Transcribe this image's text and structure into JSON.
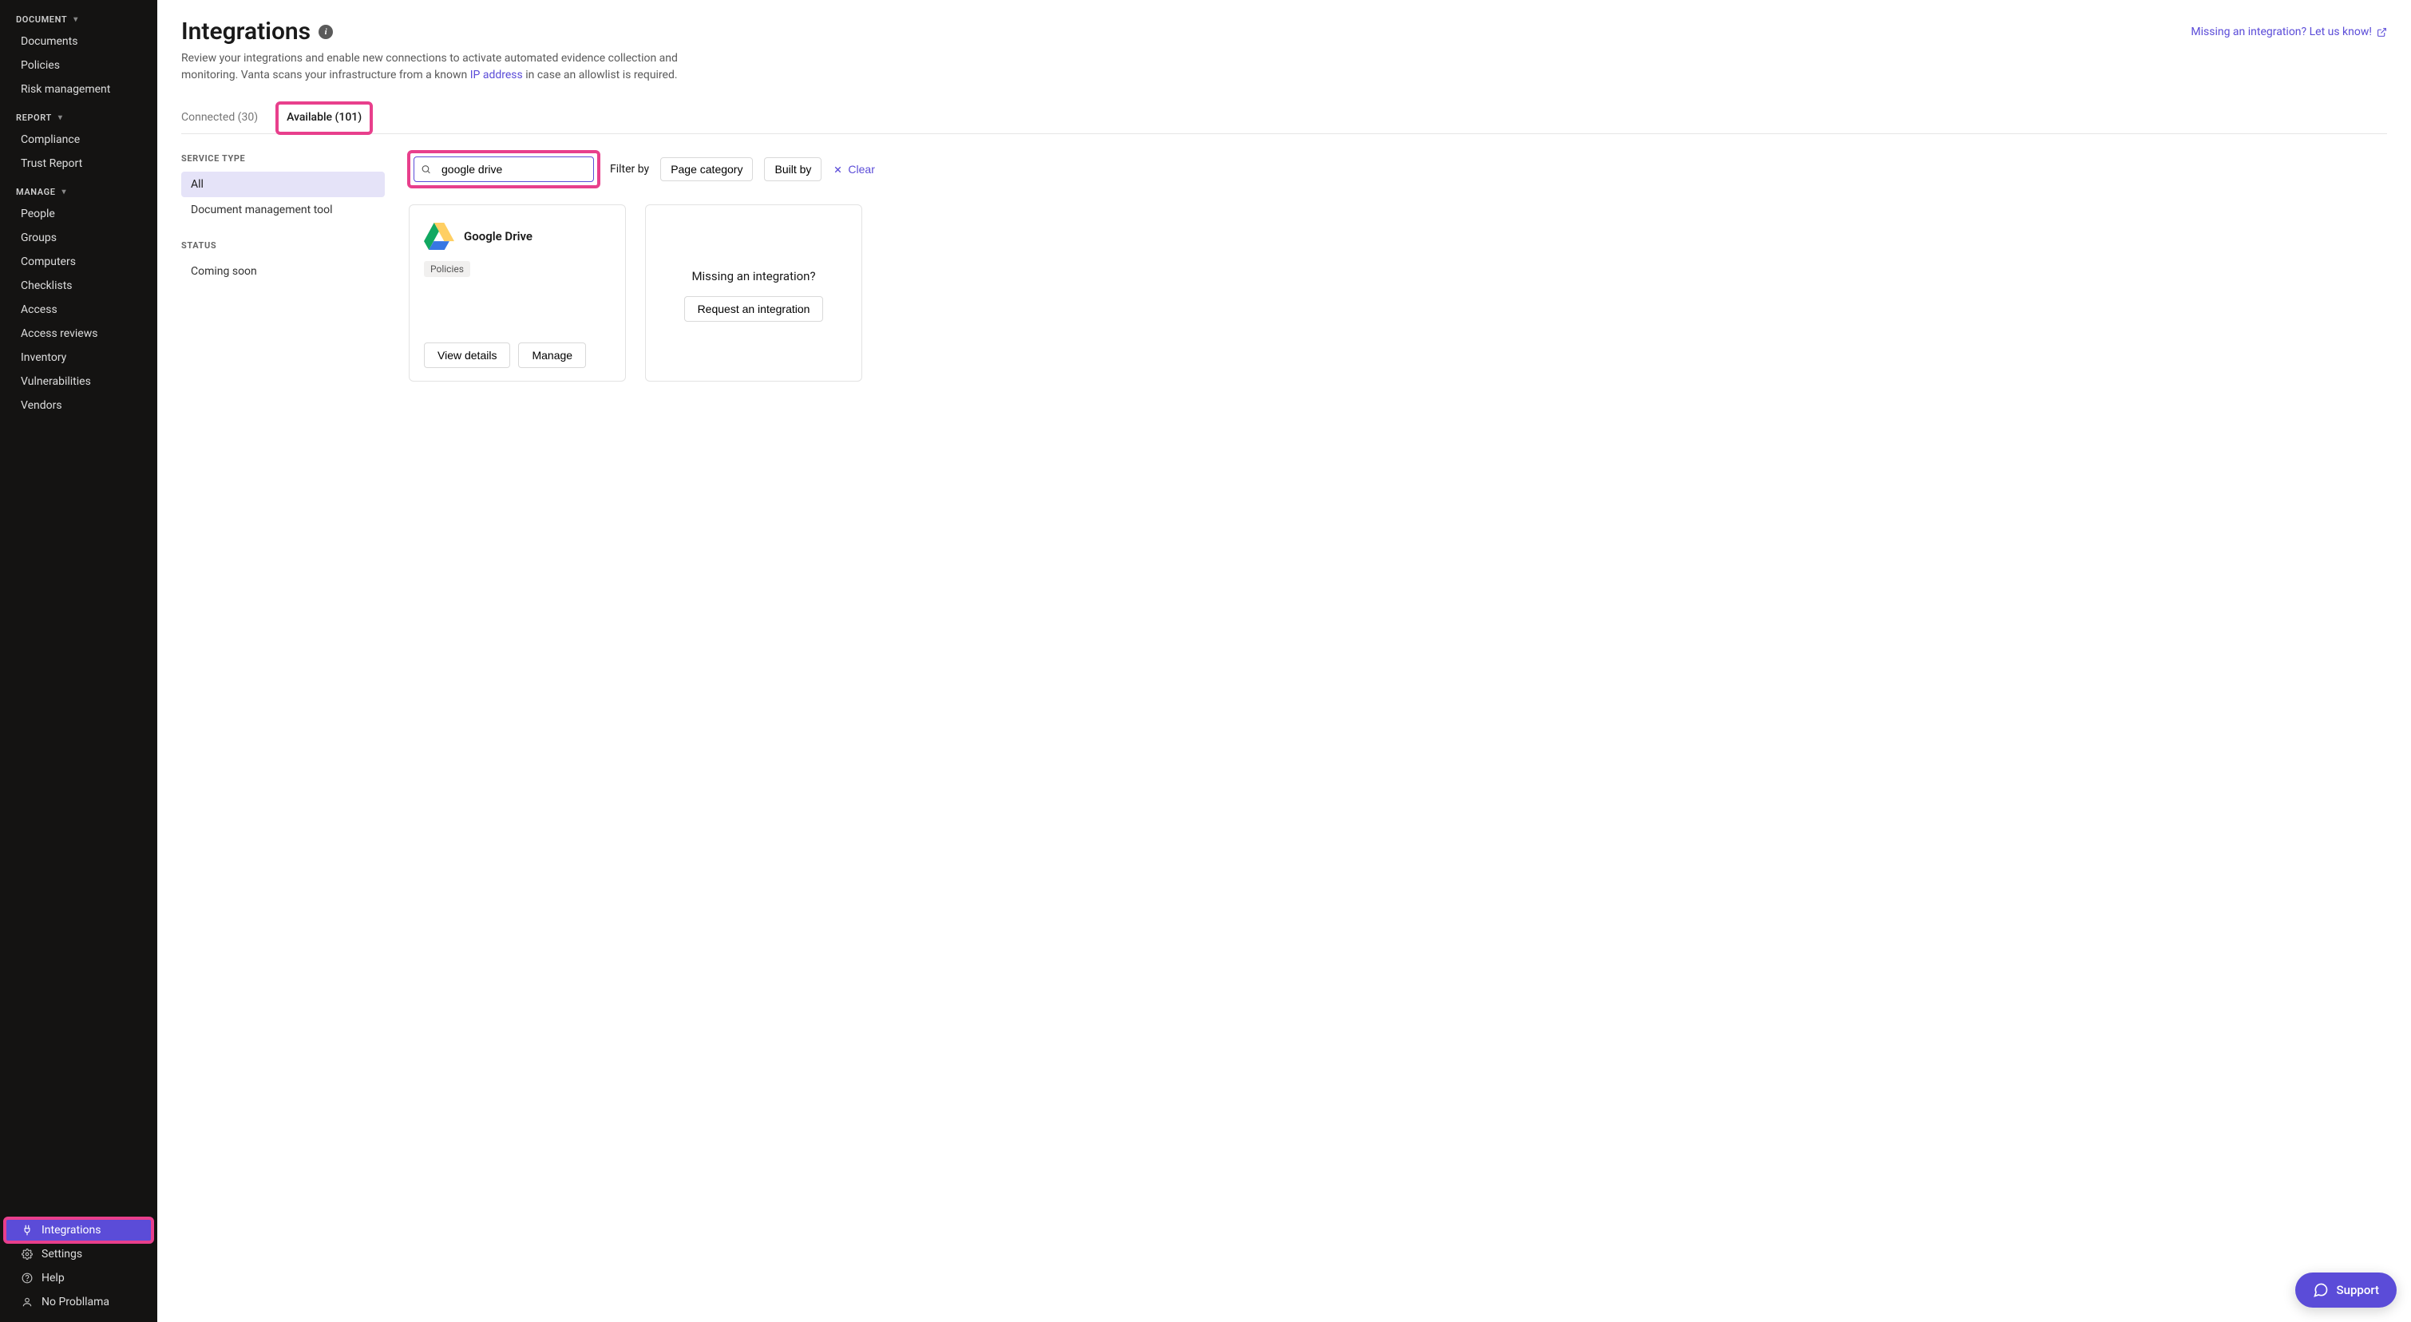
{
  "sidebar": {
    "sections": [
      {
        "label": "DOCUMENT",
        "items": [
          "Documents",
          "Policies",
          "Risk management"
        ]
      },
      {
        "label": "REPORT",
        "items": [
          "Compliance",
          "Trust Report"
        ]
      },
      {
        "label": "MANAGE",
        "items": [
          "People",
          "Groups",
          "Computers",
          "Checklists",
          "Access",
          "Access reviews",
          "Inventory",
          "Vulnerabilities",
          "Vendors"
        ]
      }
    ],
    "bottom": {
      "integrations": "Integrations",
      "settings": "Settings",
      "help": "Help",
      "user": "No Probllama"
    }
  },
  "header": {
    "title": "Integrations",
    "subtitle_pre": "Review your integrations and enable new connections to activate automated evidence collection and monitoring. Vanta scans your infrastructure from a known ",
    "ip_link": "IP address",
    "subtitle_post": " in case an allowlist is required.",
    "missing_link": "Missing an integration? Let us know!"
  },
  "tabs": {
    "connected": "Connected (30)",
    "available": "Available (101)"
  },
  "filters": {
    "service_type_heading": "SERVICE TYPE",
    "service_types": [
      "All",
      "Document management tool"
    ],
    "status_heading": "STATUS",
    "statuses": [
      "Coming soon"
    ]
  },
  "filter_bar": {
    "search_value": "google drive",
    "filter_by": "Filter by",
    "page_category": "Page category",
    "built_by": "Built by",
    "clear": "Clear"
  },
  "results": [
    {
      "name": "Google Drive",
      "badge": "Policies",
      "view_details": "View details",
      "manage": "Manage"
    }
  ],
  "missing_card": {
    "prompt": "Missing an integration?",
    "button": "Request an integration"
  },
  "support": "Support"
}
